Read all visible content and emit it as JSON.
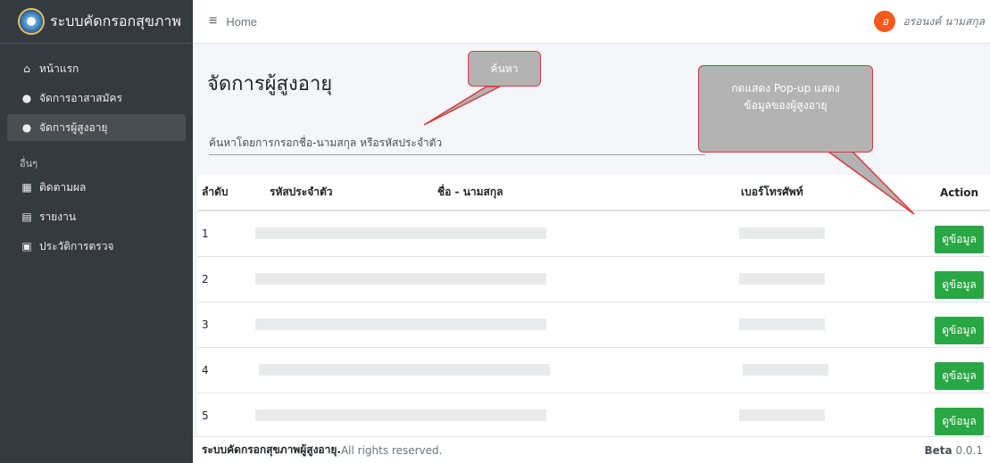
{
  "app": {
    "title": "ระบบคัดกรอกสุขภาพ"
  },
  "sidebar": {
    "items": [
      {
        "label": "หน้าแรก",
        "icon": "home-icon"
      },
      {
        "label": "จัดการอาสาสมัคร",
        "icon": "user-group-icon"
      },
      {
        "label": "จัดการผู้สูงอายุ",
        "icon": "users-icon",
        "active": true
      }
    ],
    "section_label": "อื่นๆ",
    "other_items": [
      {
        "label": "ติดตามผล",
        "icon": "calendar-icon"
      },
      {
        "label": "รายงาน",
        "icon": "report-icon"
      },
      {
        "label": "ประวัติการตรวจ",
        "icon": "history-icon"
      }
    ]
  },
  "topbar": {
    "home": "Home",
    "user_initial": "อ",
    "user_name": "อรอนงค์ นามสกุล"
  },
  "main": {
    "title": "จัดการผู้สูงอายุ",
    "search_placeholder": "ค้นหาโดยการกรอกชื่อ-นามสกุล หรือรหัสประจำตัว",
    "table": {
      "headers": [
        "ลำดับ",
        "รหัสประจำตัว",
        "ชื่อ - นามสกุล",
        "เบอร์โทรศัพท์",
        "Action"
      ],
      "rows": [
        {
          "no": "1",
          "button": "ดูข้อมูล"
        },
        {
          "no": "2",
          "button": "ดูข้อมูล"
        },
        {
          "no": "3",
          "button": "ดูข้อมูล"
        },
        {
          "no": "4",
          "button": "ดูข้อมูล"
        },
        {
          "no": "5",
          "button": "ดูข้อมูล"
        }
      ]
    }
  },
  "annotations": {
    "search": "ค้นหา",
    "popup_line1": "กดแสดง Pop-up แสดง",
    "popup_line2": "ข้อมูลของผู้สูงอายุ"
  },
  "footer": {
    "brand": "ระบบคัดกรอกสุขภาพผู้สูงอายุ.",
    "rights": "All rights reserved.",
    "version_label": "Beta",
    "version": "0.0.1"
  },
  "colors": {
    "sidebar": "#343a40",
    "accent_button": "#28a745",
    "avatar": "#f55a1c",
    "callout_border": "#d93a3a",
    "callout_fill": "#b3b3b3"
  }
}
